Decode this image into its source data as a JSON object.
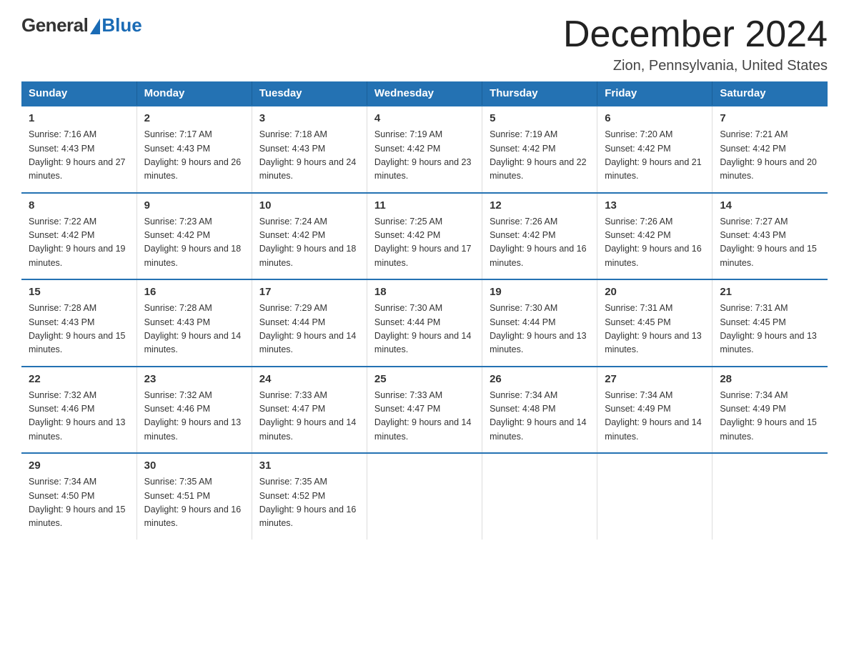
{
  "logo": {
    "general": "General",
    "blue": "Blue"
  },
  "title": "December 2024",
  "location": "Zion, Pennsylvania, United States",
  "days_of_week": [
    "Sunday",
    "Monday",
    "Tuesday",
    "Wednesday",
    "Thursday",
    "Friday",
    "Saturday"
  ],
  "weeks": [
    [
      {
        "day": "1",
        "sunrise": "7:16 AM",
        "sunset": "4:43 PM",
        "daylight": "9 hours and 27 minutes."
      },
      {
        "day": "2",
        "sunrise": "7:17 AM",
        "sunset": "4:43 PM",
        "daylight": "9 hours and 26 minutes."
      },
      {
        "day": "3",
        "sunrise": "7:18 AM",
        "sunset": "4:43 PM",
        "daylight": "9 hours and 24 minutes."
      },
      {
        "day": "4",
        "sunrise": "7:19 AM",
        "sunset": "4:42 PM",
        "daylight": "9 hours and 23 minutes."
      },
      {
        "day": "5",
        "sunrise": "7:19 AM",
        "sunset": "4:42 PM",
        "daylight": "9 hours and 22 minutes."
      },
      {
        "day": "6",
        "sunrise": "7:20 AM",
        "sunset": "4:42 PM",
        "daylight": "9 hours and 21 minutes."
      },
      {
        "day": "7",
        "sunrise": "7:21 AM",
        "sunset": "4:42 PM",
        "daylight": "9 hours and 20 minutes."
      }
    ],
    [
      {
        "day": "8",
        "sunrise": "7:22 AM",
        "sunset": "4:42 PM",
        "daylight": "9 hours and 19 minutes."
      },
      {
        "day": "9",
        "sunrise": "7:23 AM",
        "sunset": "4:42 PM",
        "daylight": "9 hours and 18 minutes."
      },
      {
        "day": "10",
        "sunrise": "7:24 AM",
        "sunset": "4:42 PM",
        "daylight": "9 hours and 18 minutes."
      },
      {
        "day": "11",
        "sunrise": "7:25 AM",
        "sunset": "4:42 PM",
        "daylight": "9 hours and 17 minutes."
      },
      {
        "day": "12",
        "sunrise": "7:26 AM",
        "sunset": "4:42 PM",
        "daylight": "9 hours and 16 minutes."
      },
      {
        "day": "13",
        "sunrise": "7:26 AM",
        "sunset": "4:42 PM",
        "daylight": "9 hours and 16 minutes."
      },
      {
        "day": "14",
        "sunrise": "7:27 AM",
        "sunset": "4:43 PM",
        "daylight": "9 hours and 15 minutes."
      }
    ],
    [
      {
        "day": "15",
        "sunrise": "7:28 AM",
        "sunset": "4:43 PM",
        "daylight": "9 hours and 15 minutes."
      },
      {
        "day": "16",
        "sunrise": "7:28 AM",
        "sunset": "4:43 PM",
        "daylight": "9 hours and 14 minutes."
      },
      {
        "day": "17",
        "sunrise": "7:29 AM",
        "sunset": "4:44 PM",
        "daylight": "9 hours and 14 minutes."
      },
      {
        "day": "18",
        "sunrise": "7:30 AM",
        "sunset": "4:44 PM",
        "daylight": "9 hours and 14 minutes."
      },
      {
        "day": "19",
        "sunrise": "7:30 AM",
        "sunset": "4:44 PM",
        "daylight": "9 hours and 13 minutes."
      },
      {
        "day": "20",
        "sunrise": "7:31 AM",
        "sunset": "4:45 PM",
        "daylight": "9 hours and 13 minutes."
      },
      {
        "day": "21",
        "sunrise": "7:31 AM",
        "sunset": "4:45 PM",
        "daylight": "9 hours and 13 minutes."
      }
    ],
    [
      {
        "day": "22",
        "sunrise": "7:32 AM",
        "sunset": "4:46 PM",
        "daylight": "9 hours and 13 minutes."
      },
      {
        "day": "23",
        "sunrise": "7:32 AM",
        "sunset": "4:46 PM",
        "daylight": "9 hours and 13 minutes."
      },
      {
        "day": "24",
        "sunrise": "7:33 AM",
        "sunset": "4:47 PM",
        "daylight": "9 hours and 14 minutes."
      },
      {
        "day": "25",
        "sunrise": "7:33 AM",
        "sunset": "4:47 PM",
        "daylight": "9 hours and 14 minutes."
      },
      {
        "day": "26",
        "sunrise": "7:34 AM",
        "sunset": "4:48 PM",
        "daylight": "9 hours and 14 minutes."
      },
      {
        "day": "27",
        "sunrise": "7:34 AM",
        "sunset": "4:49 PM",
        "daylight": "9 hours and 14 minutes."
      },
      {
        "day": "28",
        "sunrise": "7:34 AM",
        "sunset": "4:49 PM",
        "daylight": "9 hours and 15 minutes."
      }
    ],
    [
      {
        "day": "29",
        "sunrise": "7:34 AM",
        "sunset": "4:50 PM",
        "daylight": "9 hours and 15 minutes."
      },
      {
        "day": "30",
        "sunrise": "7:35 AM",
        "sunset": "4:51 PM",
        "daylight": "9 hours and 16 minutes."
      },
      {
        "day": "31",
        "sunrise": "7:35 AM",
        "sunset": "4:52 PM",
        "daylight": "9 hours and 16 minutes."
      },
      null,
      null,
      null,
      null
    ]
  ]
}
